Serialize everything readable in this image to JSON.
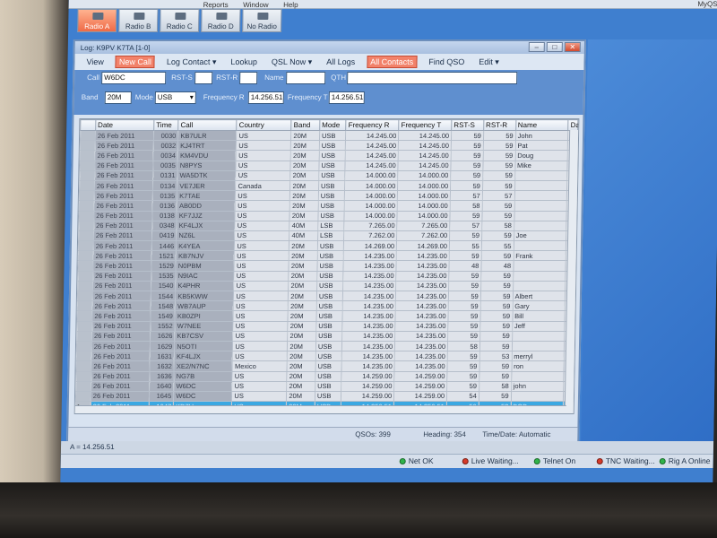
{
  "app": {
    "menu": [
      "",
      "",
      "",
      "Reports",
      "Window",
      "Help"
    ],
    "title_right": "MyQS",
    "radio_tabs": [
      {
        "label": "Radio A",
        "active": true
      },
      {
        "label": "Radio B",
        "active": false
      },
      {
        "label": "Radio C",
        "active": false
      },
      {
        "label": "Radio D",
        "active": false
      },
      {
        "label": "No Radio",
        "active": false
      }
    ]
  },
  "log_window": {
    "title": "Log: K9PV  K7TA  [1-0]",
    "controls": {
      "minimize": "–",
      "maximize": "□",
      "close": "✕"
    },
    "menu": [
      {
        "label": "View",
        "hot": false
      },
      {
        "label": "New Call",
        "hot": true
      },
      {
        "label": "Log Contact ▾",
        "hot": false
      },
      {
        "label": "Lookup",
        "hot": false
      },
      {
        "label": "QSL Now ▾",
        "hot": false
      },
      {
        "label": "All Logs",
        "hot": false
      },
      {
        "label": "All Contacts",
        "hot": true
      },
      {
        "label": "Find QSO",
        "hot": false
      },
      {
        "label": "Edit ▾",
        "hot": false
      }
    ],
    "entry": {
      "call_label": "Call",
      "call_value": "W6DC",
      "rsts_label": "RST-S",
      "rsts_value": "",
      "rstr_label": "RST-R",
      "rstr_value": "",
      "name_label": "Name",
      "name_value": "",
      "qth_label": "QTH",
      "qth_value": "",
      "band_label": "Band",
      "band_value": "20M",
      "mode_label": "Mode",
      "mode_value": "USB",
      "freqr_label": "Frequency R",
      "freqr_value": "14.256.51",
      "freqt_label": "Frequency T",
      "freqt_value": "14.256.51"
    },
    "columns": [
      "",
      "Date",
      "Time",
      "Call",
      "Country",
      "Band",
      "Mode",
      "Frequency R",
      "Frequency T",
      "RST-S",
      "RST-R",
      "Name",
      "Da"
    ],
    "rows": [
      [
        "26 Feb 2011",
        "0030",
        "KB7ULR",
        "US",
        "20M",
        "USB",
        "14.245.00",
        "14.245.00",
        "59",
        "59",
        "John"
      ],
      [
        "26 Feb 2011",
        "0032",
        "KJ4TRT",
        "US",
        "20M",
        "USB",
        "14.245.00",
        "14.245.00",
        "59",
        "59",
        "Pat"
      ],
      [
        "26 Feb 2011",
        "0034",
        "KM4VDU",
        "US",
        "20M",
        "USB",
        "14.245.00",
        "14.245.00",
        "59",
        "59",
        "Doug"
      ],
      [
        "26 Feb 2011",
        "0035",
        "N8PYS",
        "US",
        "20M",
        "USB",
        "14.245.00",
        "14.245.00",
        "59",
        "59",
        "Mike"
      ],
      [
        "26 Feb 2011",
        "0131",
        "WA5DTK",
        "US",
        "20M",
        "USB",
        "14.000.00",
        "14.000.00",
        "59",
        "59",
        ""
      ],
      [
        "26 Feb 2011",
        "0134",
        "VE7JER",
        "Canada",
        "20M",
        "USB",
        "14.000.00",
        "14.000.00",
        "59",
        "59",
        ""
      ],
      [
        "26 Feb 2011",
        "0135",
        "K7TAE",
        "US",
        "20M",
        "USB",
        "14.000.00",
        "14.000.00",
        "57",
        "57",
        ""
      ],
      [
        "26 Feb 2011",
        "0136",
        "AB0DD",
        "US",
        "20M",
        "USB",
        "14.000.00",
        "14.000.00",
        "58",
        "59",
        ""
      ],
      [
        "26 Feb 2011",
        "0138",
        "KF7JJZ",
        "US",
        "20M",
        "USB",
        "14.000.00",
        "14.000.00",
        "59",
        "59",
        ""
      ],
      [
        "26 Feb 2011",
        "0348",
        "KF4LJX",
        "US",
        "40M",
        "LSB",
        "7.265.00",
        "7.265.00",
        "57",
        "58",
        ""
      ],
      [
        "26 Feb 2011",
        "0419",
        "NZ6L",
        "US",
        "40M",
        "LSB",
        "7.262.00",
        "7.262.00",
        "59",
        "59",
        "Joe"
      ],
      [
        "26 Feb 2011",
        "1446",
        "K4YEA",
        "US",
        "20M",
        "USB",
        "14.269.00",
        "14.269.00",
        "55",
        "55",
        ""
      ],
      [
        "26 Feb 2011",
        "1521",
        "KB7NJV",
        "US",
        "20M",
        "USB",
        "14.235.00",
        "14.235.00",
        "59",
        "59",
        "Frank"
      ],
      [
        "26 Feb 2011",
        "1529",
        "N0PBM",
        "US",
        "20M",
        "USB",
        "14.235.00",
        "14.235.00",
        "48",
        "48",
        ""
      ],
      [
        "26 Feb 2011",
        "1535",
        "N9IAC",
        "US",
        "20M",
        "USB",
        "14.235.00",
        "14.235.00",
        "59",
        "59",
        ""
      ],
      [
        "26 Feb 2011",
        "1540",
        "K4PHR",
        "US",
        "20M",
        "USB",
        "14.235.00",
        "14.235.00",
        "59",
        "59",
        ""
      ],
      [
        "26 Feb 2011",
        "1544",
        "KB5KWW",
        "US",
        "20M",
        "USB",
        "14.235.00",
        "14.235.00",
        "59",
        "59",
        "Albert"
      ],
      [
        "26 Feb 2011",
        "1548",
        "WB7AUP",
        "US",
        "20M",
        "USB",
        "14.235.00",
        "14.235.00",
        "59",
        "59",
        "Gary"
      ],
      [
        "26 Feb 2011",
        "1549",
        "KB0ZPI",
        "US",
        "20M",
        "USB",
        "14.235.00",
        "14.235.00",
        "59",
        "59",
        "Bill"
      ],
      [
        "26 Feb 2011",
        "1552",
        "W7NEE",
        "US",
        "20M",
        "USB",
        "14.235.00",
        "14.235.00",
        "59",
        "59",
        "Jeff"
      ],
      [
        "26 Feb 2011",
        "1626",
        "KB7CSV",
        "US",
        "20M",
        "USB",
        "14.235.00",
        "14.235.00",
        "59",
        "59",
        ""
      ],
      [
        "26 Feb 2011",
        "1629",
        "N5OTI",
        "US",
        "20M",
        "USB",
        "14.235.00",
        "14.235.00",
        "58",
        "59",
        ""
      ],
      [
        "26 Feb 2011",
        "1631",
        "KF4LJX",
        "US",
        "20M",
        "USB",
        "14.235.00",
        "14.235.00",
        "59",
        "53",
        "merryl"
      ],
      [
        "26 Feb 2011",
        "1632",
        "XE2/N7NC",
        "Mexico",
        "20M",
        "USB",
        "14.235.00",
        "14.235.00",
        "59",
        "59",
        "ron"
      ],
      [
        "26 Feb 2011",
        "1636",
        "NG7B",
        "US",
        "20M",
        "USB",
        "14.259.00",
        "14.259.00",
        "59",
        "59",
        ""
      ],
      [
        "26 Feb 2011",
        "1640",
        "W6DC",
        "US",
        "20M",
        "USB",
        "14.259.00",
        "14.259.00",
        "59",
        "58",
        "john"
      ],
      [
        "26 Feb 2011",
        "1645",
        "W6DC",
        "US",
        "20M",
        "USB",
        "14.259.00",
        "14.259.00",
        "54",
        "59",
        ""
      ],
      [
        "26 Feb 2011",
        "1647",
        "KD7H",
        "US",
        "20M",
        "USB",
        "14.256.51",
        "14.256.51",
        "56",
        "58",
        "BOB"
      ]
    ],
    "current_row_index": 27,
    "status": {
      "qsos": "QSOs: 399",
      "heading": "Heading: 354",
      "time_date": "Time/Date: Automatic"
    }
  },
  "main_status": "A = 14.256.51",
  "connections": [
    {
      "label": "Net OK",
      "led": "green"
    },
    {
      "label": "Live Waiting...",
      "led": "red"
    },
    {
      "label": "Telnet On",
      "led": "green"
    },
    {
      "label": "TNC Waiting...",
      "led": "red"
    },
    {
      "label": "Rig A Online",
      "led": "green"
    }
  ]
}
